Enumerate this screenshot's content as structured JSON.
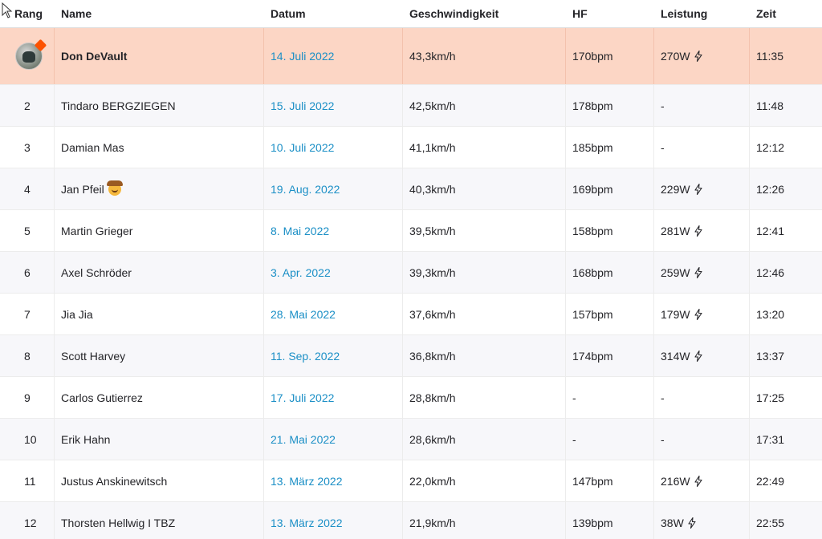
{
  "header": {
    "rank": "Rang",
    "name": "Name",
    "date": "Datum",
    "speed": "Geschwindigkeit",
    "hf": "HF",
    "power": "Leistung",
    "time": "Zeit"
  },
  "rows": [
    {
      "rank": "",
      "name": "Don DeVault",
      "date": "14. Juli 2022",
      "speed": "43,3km/h",
      "hf": "170bpm",
      "power": "270W",
      "time": "11:35"
    },
    {
      "rank": "2",
      "name": "Tindaro BERGZIEGEN",
      "date": "15. Juli 2022",
      "speed": "42,5km/h",
      "hf": "178bpm",
      "power": "-",
      "time": "11:48"
    },
    {
      "rank": "3",
      "name": "Damian Mas",
      "date": "10. Juli 2022",
      "speed": "41,1km/h",
      "hf": "185bpm",
      "power": "-",
      "time": "12:12"
    },
    {
      "rank": "4",
      "name": "Jan Pfeil",
      "date": "19. Aug. 2022",
      "speed": "40,3km/h",
      "hf": "169bpm",
      "power": "229W",
      "time": "12:26"
    },
    {
      "rank": "5",
      "name": "Martin Grieger",
      "date": "8. Mai 2022",
      "speed": "39,5km/h",
      "hf": "158bpm",
      "power": "281W",
      "time": "12:41"
    },
    {
      "rank": "6",
      "name": "Axel Schröder",
      "date": "3. Apr. 2022",
      "speed": "39,3km/h",
      "hf": "168bpm",
      "power": "259W",
      "time": "12:46"
    },
    {
      "rank": "7",
      "name": "Jia Jia",
      "date": "28. Mai 2022",
      "speed": "37,6km/h",
      "hf": "157bpm",
      "power": "179W",
      "time": "13:20"
    },
    {
      "rank": "8",
      "name": "Scott Harvey",
      "date": "11. Sep. 2022",
      "speed": "36,8km/h",
      "hf": "174bpm",
      "power": "314W",
      "time": "13:37"
    },
    {
      "rank": "9",
      "name": "Carlos Gutierrez",
      "date": "17. Juli 2022",
      "speed": "28,8km/h",
      "hf": "-",
      "power": "-",
      "time": "17:25"
    },
    {
      "rank": "10",
      "name": "Erik Hahn",
      "date": "21. Mai 2022",
      "speed": "28,6km/h",
      "hf": "-",
      "power": "-",
      "time": "17:31"
    },
    {
      "rank": "11",
      "name": "Justus Anskinewitsch",
      "date": "13. März 2022",
      "speed": "22,0km/h",
      "hf": "147bpm",
      "power": "216W",
      "time": "22:49"
    },
    {
      "rank": "12",
      "name": "Thorsten Hellwig I TBZ",
      "date": "13. März 2022",
      "speed": "21,9km/h",
      "hf": "139bpm",
      "power": "38W",
      "time": "22:55"
    }
  ],
  "icons": {
    "power": "lightning-bolt-icon",
    "avatar_badge": "strava-badge-icon",
    "name_emoji": "cowboy-emoji-icon"
  },
  "colors": {
    "highlight_row": "#fcd6c5",
    "date_link": "#1b8fc6",
    "alt_row": "#f7f7fa"
  }
}
